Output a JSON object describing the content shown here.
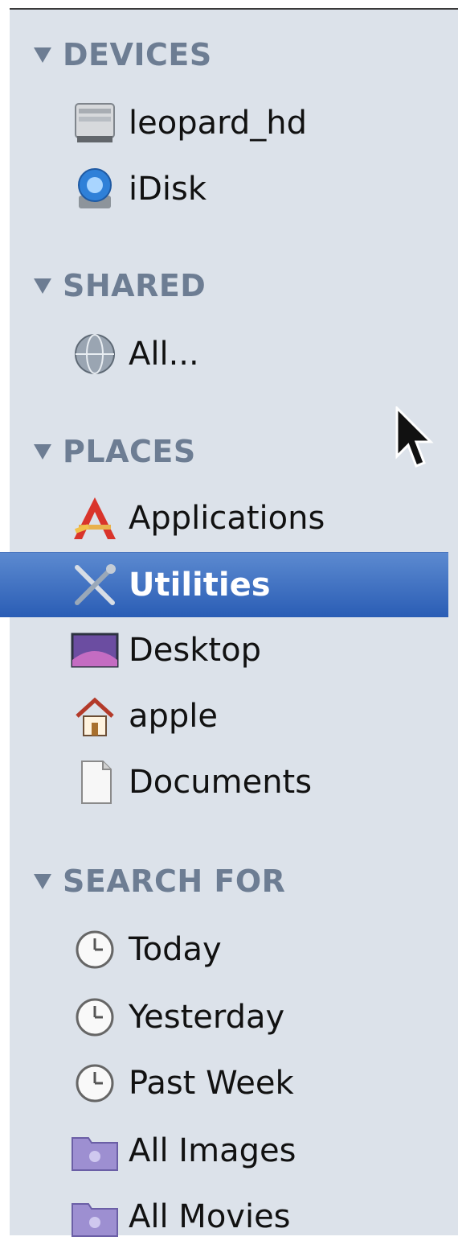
{
  "sections": [
    {
      "title": "DEVICES",
      "items": [
        {
          "label": "leopard_hd",
          "icon": "hard-drive-icon"
        },
        {
          "label": "iDisk",
          "icon": "idisk-icon"
        }
      ]
    },
    {
      "title": "SHARED",
      "items": [
        {
          "label": "All...",
          "icon": "network-globe-icon"
        }
      ]
    },
    {
      "title": "PLACES",
      "items": [
        {
          "label": "Applications",
          "icon": "applications-icon"
        },
        {
          "label": "Utilities",
          "icon": "utilities-icon",
          "selected": true
        },
        {
          "label": "Desktop",
          "icon": "desktop-icon"
        },
        {
          "label": "apple",
          "icon": "home-icon"
        },
        {
          "label": "Documents",
          "icon": "documents-icon"
        }
      ]
    },
    {
      "title": "SEARCH FOR",
      "items": [
        {
          "label": "Today",
          "icon": "clock-icon"
        },
        {
          "label": "Yesterday",
          "icon": "clock-icon"
        },
        {
          "label": "Past Week",
          "icon": "clock-icon"
        },
        {
          "label": "All Images",
          "icon": "smart-folder-icon"
        },
        {
          "label": "All Movies",
          "icon": "smart-folder-icon"
        }
      ]
    }
  ],
  "colors": {
    "sidebar_bg": "#dce2ea",
    "section_header": "#6d7d93",
    "selection": "#2a5db5"
  }
}
